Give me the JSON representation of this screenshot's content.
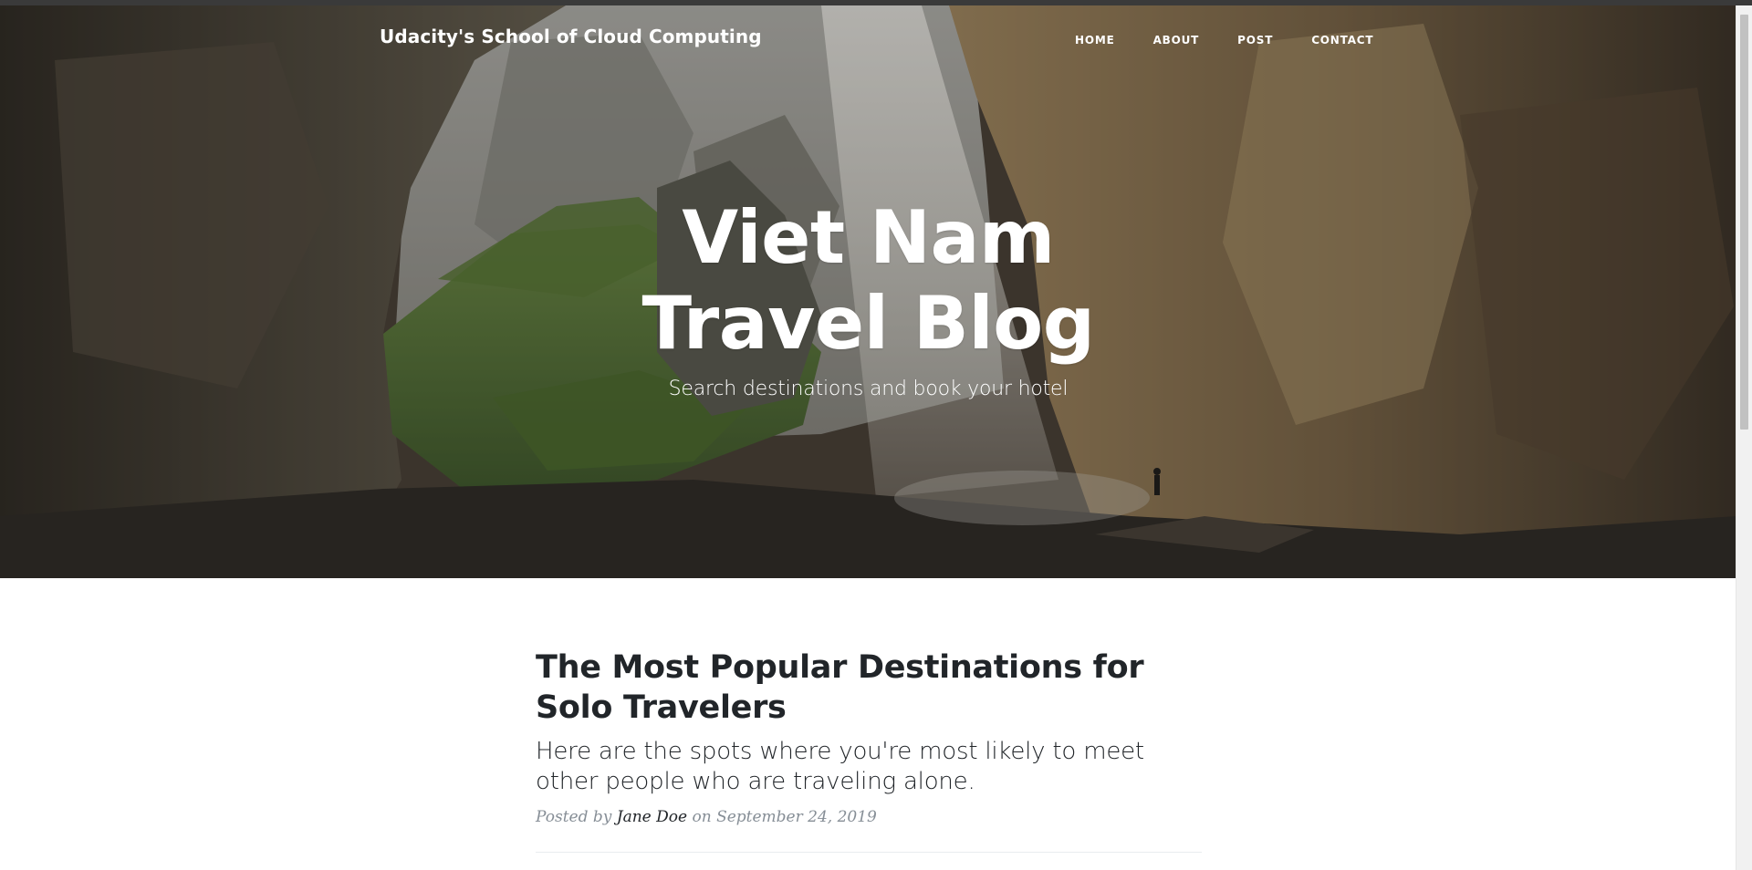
{
  "site": {
    "brand": "Udacity's School of Cloud Computing",
    "nav": [
      {
        "label": "HOME"
      },
      {
        "label": "ABOUT"
      },
      {
        "label": "POST"
      },
      {
        "label": "CONTACT"
      }
    ]
  },
  "hero": {
    "title_line1": "Viet Nam",
    "title_line2": "Travel Blog",
    "subtitle": "Search destinations and book your hotel"
  },
  "post": {
    "title": "The Most Popular Destinations for Solo Travelers",
    "subtitle": "Here are the spots where you're most likely to meet other people who are traveling alone.",
    "meta_prefix": "Posted by",
    "author": "Jane Doe",
    "meta_suffix": "on September 24, 2019"
  },
  "colors": {
    "text_dark": "#212529",
    "meta_gray": "#868e96",
    "hero_rock": "#5a4a36",
    "hero_moss": "#4f7a2e"
  }
}
